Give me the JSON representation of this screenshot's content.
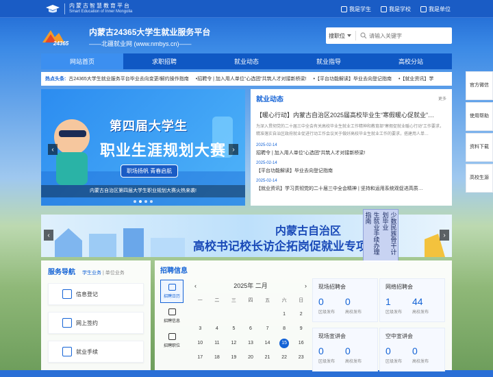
{
  "colors": {
    "accent": "#1463d6",
    "nav_bg": "#0f58c4",
    "nav_active": "#3c8ff0"
  },
  "topbar": {
    "logo_cn": "内蒙古智慧教育平台",
    "logo_en": "Smart Education of Inner Mongolia",
    "links": [
      {
        "icon": "student-icon",
        "label": "我是学生"
      },
      {
        "icon": "school-icon",
        "label": "我是学校"
      },
      {
        "icon": "company-icon",
        "label": "我是单位"
      }
    ]
  },
  "brand": {
    "title": "内蒙古24365大学生就业服务平台",
    "subtitle": "——北疆就业网 (www.nmbys.cn)——"
  },
  "search": {
    "scope": "搜职位",
    "placeholder": "请输入关键字"
  },
  "nav": [
    "网站首页",
    "求职招聘",
    "就业动态",
    "就业指导",
    "高校分站"
  ],
  "ticker": {
    "hot_label": "热点头条:",
    "messages": [
      "古24365大学生就业服务平台毕业去向变更/解约操作指南",
      "•招聘令 | 加入用人单位“心选团”共筑人才对接新桥梁!",
      "•【平台功能解读】毕业去向登记指南",
      "•【就业资讯】学"
    ]
  },
  "side": [
    "官方微信",
    "使用帮助",
    "资料下载",
    "高校生源"
  ],
  "banner": {
    "line1": "第四届大学生",
    "line2": "职业生涯规划大赛",
    "pill": "职场扬帆 青春启航",
    "caption": "内蒙古自治区第四届大学生职业规划大赛火热来袭!"
  },
  "news": {
    "title": "就业动态",
    "more": "更多",
    "lead": "【暖心行动】内蒙古自治区2025届高校毕业生“寒假暖心促就业”…",
    "summary": "为深入贯彻党的二十届三中全会有关高校毕业生就业工作精神和教育部“寒假促就业暖心行动”工作要求，精准落实自治区政府就业促进行动工作会议关于做好高校毕业生就业工作的要求，搭建用人单…",
    "items": [
      {
        "date": "2025-02-14",
        "text": "招聘令 | 加入用人单位“心选团”共筑人才对接新桥梁!"
      },
      {
        "date": "2025-02-14",
        "text": "【平台功能解读】毕业去向登记指南"
      },
      {
        "date": "2025-02-14",
        "text": "【就业资讯】学习贯彻党的二十届三中全会精神 | 坚持和运用系统观促进高质…"
      }
    ]
  },
  "banner2": {
    "line1": "内蒙古自治区",
    "line2": "高校书记校长访企拓岗促就业专项行动"
  },
  "popup": {
    "lines": [
      "少数民族骨干计划毕业",
      "生就业手续办理指南"
    ]
  },
  "services": {
    "title": "服务导航",
    "tabs": [
      "学生业务",
      "单位业务"
    ],
    "cards": [
      {
        "icon": "edit-icon",
        "label": "信息登记"
      },
      {
        "icon": "contract-icon",
        "label": "网上签约"
      },
      {
        "icon": "procedure-icon",
        "label": "就业手续"
      }
    ]
  },
  "recruit": {
    "title": "招聘信息",
    "vtabs": [
      {
        "icon": "calendar-icon",
        "label": "招聘日历"
      },
      {
        "icon": "info-icon",
        "label": "招聘信息"
      },
      {
        "icon": "briefcase-icon",
        "label": "招聘职位"
      }
    ],
    "calendar": {
      "month": "2025年 二月",
      "weekdays": [
        "一",
        "二",
        "三",
        "四",
        "五",
        "六",
        "日"
      ],
      "rows": [
        [
          "",
          "",
          "",
          "",
          "",
          "1",
          "2"
        ],
        [
          "3",
          "4",
          "5",
          "6",
          "7",
          "8",
          "9"
        ],
        [
          "10",
          "11",
          "12",
          "13",
          "14",
          "15",
          "16"
        ],
        [
          "17",
          "18",
          "19",
          "20",
          "21",
          "22",
          "23"
        ]
      ],
      "today": "15"
    },
    "stats": [
      {
        "name": "现场招聘会",
        "a_num": "0",
        "a_label": "区级发布",
        "b_num": "0",
        "b_label": "高校发布"
      },
      {
        "name": "网络招聘会",
        "a_num": "1",
        "a_label": "区级发布",
        "b_num": "44",
        "b_label": "高校发布"
      },
      {
        "name": "现场宣讲会",
        "a_num": "0",
        "a_label": "区级发布",
        "b_num": "0",
        "b_label": "高校发布"
      },
      {
        "name": "空中宣讲会",
        "a_num": "0",
        "a_label": "区级发布",
        "b_num": "0",
        "b_label": "高校发布"
      }
    ]
  }
}
